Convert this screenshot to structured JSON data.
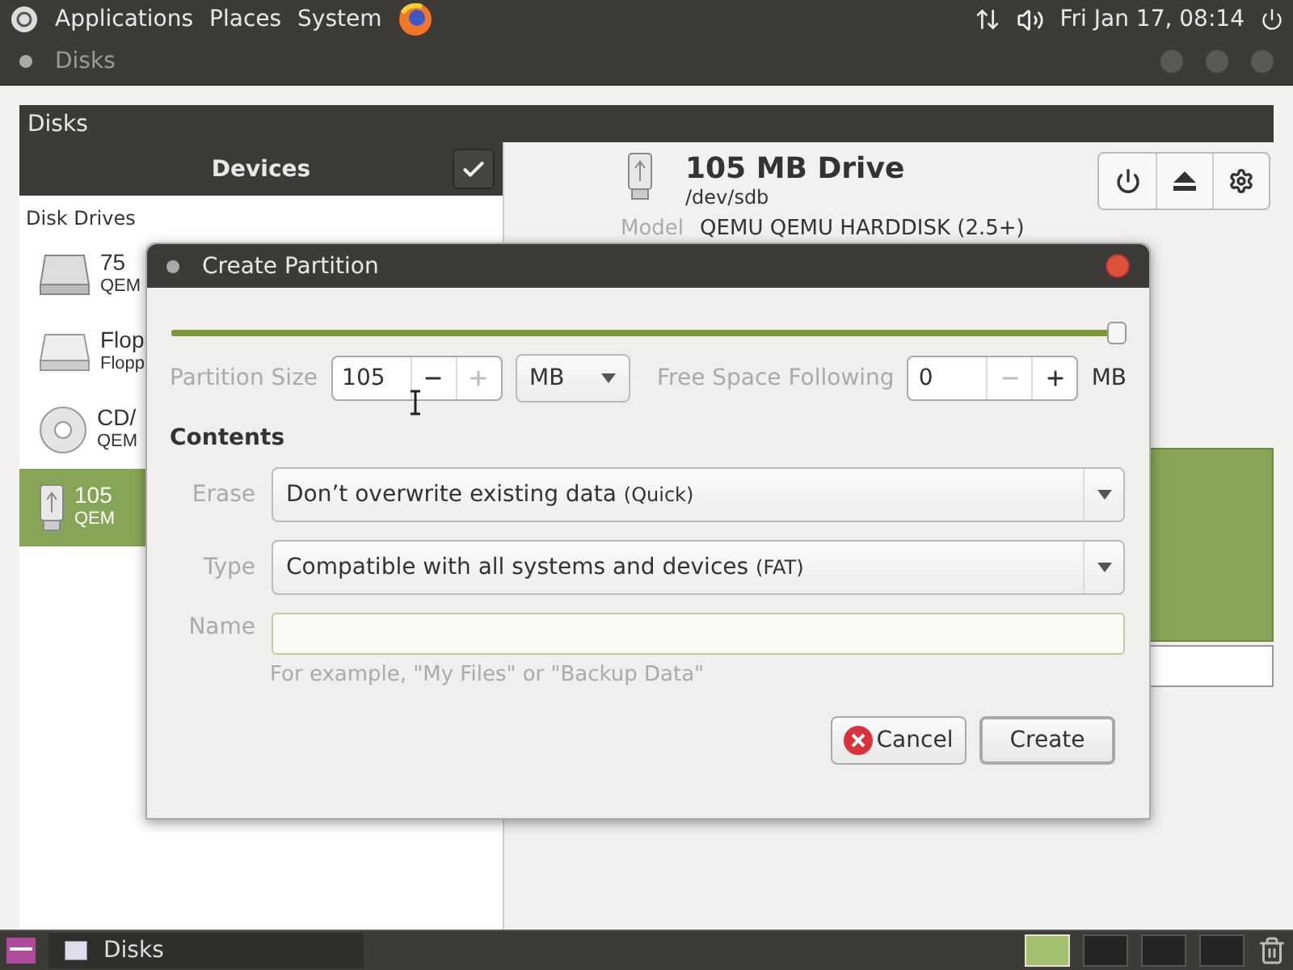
{
  "top_panel": {
    "menus": [
      "Applications",
      "Places",
      "System"
    ],
    "clock": "Fri Jan 17, 08:14"
  },
  "window": {
    "title": "Disks",
    "header": "Disks"
  },
  "devices": {
    "title": "Devices",
    "section": "Disk Drives",
    "items": [
      {
        "name": "75",
        "sub": "QEM",
        "kind": "hdd",
        "selected": false
      },
      {
        "name": "Flop",
        "sub": "Flopp",
        "kind": "floppy",
        "selected": false
      },
      {
        "name": "CD/",
        "sub": "QEM",
        "kind": "optical",
        "selected": false
      },
      {
        "name": "105",
        "sub": "QEM",
        "kind": "usb",
        "selected": true
      }
    ]
  },
  "drive": {
    "title": "105 MB Drive",
    "path": "/dev/sdb",
    "model_label": "Model",
    "model": "QEMU QEMU HARDDISK (2.5+)"
  },
  "dialog": {
    "title": "Create Partition",
    "slider": {
      "level": 1
    },
    "size": {
      "label": "Partition Size",
      "value": "105",
      "minus_disabled": false,
      "plus_disabled": true
    },
    "unit": "MB",
    "free": {
      "label": "Free Space Following",
      "value": "0",
      "minus_disabled": true,
      "plus_disabled": false,
      "unit": "MB"
    },
    "contents": "Contents",
    "erase": {
      "label": "Erase",
      "value": "Don’t overwrite existing data",
      "note": "(Quick)"
    },
    "type": {
      "label": "Type",
      "value": "Compatible with all systems and devices",
      "note": "(FAT)"
    },
    "name": {
      "label": "Name",
      "hint": "For example, \"My Files\" or \"Backup Data\""
    },
    "buttons": [
      {
        "label": "Cancel",
        "kind": "cancel"
      },
      {
        "label": "Create",
        "kind": "default"
      }
    ]
  },
  "taskbar": {
    "tasks": [
      "Disks"
    ],
    "workspaces": [
      {
        "selected": true
      },
      {
        "selected": false
      },
      {
        "selected": false
      },
      {
        "selected": false
      }
    ]
  }
}
